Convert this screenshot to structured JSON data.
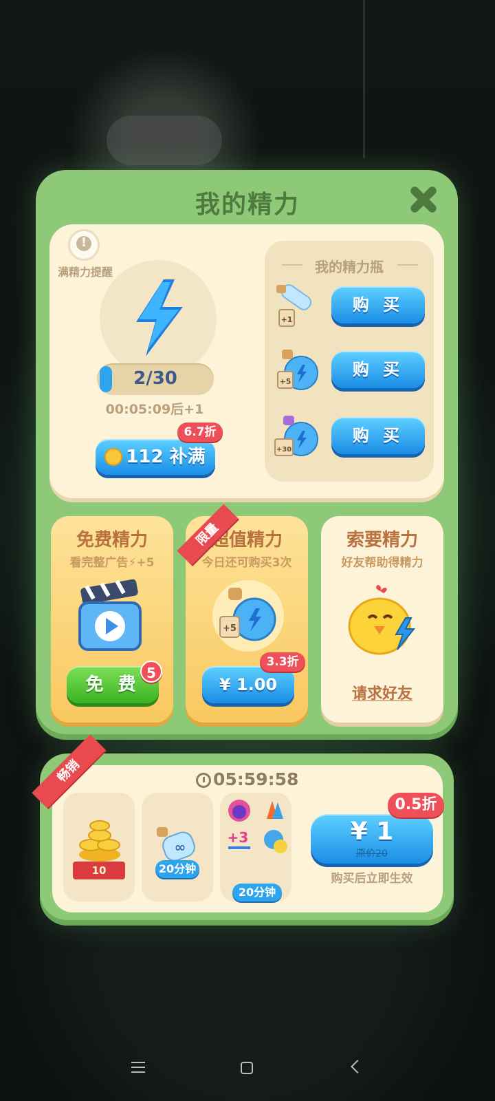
{
  "dialog": {
    "title": "我的精力",
    "reminder_label": "满精力提醒",
    "energy": {
      "current": 2,
      "max": 30,
      "text": "2/30",
      "fill_fraction": 0.067
    },
    "timer_text": "00:05:09后+1",
    "fill_button": {
      "label": "112 补满",
      "discount": "6.7折"
    }
  },
  "bottles": {
    "title": "我的精力瓶",
    "items": [
      {
        "tag": "+1",
        "buy_label": "购 买"
      },
      {
        "tag": "+5",
        "buy_label": "购 买"
      },
      {
        "tag": "+30",
        "buy_label": "购 买"
      }
    ]
  },
  "cards": [
    {
      "title": "免费精力",
      "subtitle": "看完整广告⚡+5",
      "button": "免 费",
      "badge": "5"
    },
    {
      "title": "超值精力",
      "subtitle": "今日还可购买3次",
      "ribbon": "限量",
      "tag": "+5",
      "button": "¥ 1.00",
      "discount": "3.3折"
    },
    {
      "title": "索要精力",
      "subtitle": "好友帮助得精力",
      "link": "请求好友"
    }
  ],
  "offer": {
    "ribbon": "畅销",
    "countdown": "05:59:58",
    "coins_label": "10",
    "bottle_duration": "20分钟",
    "booster_duration": "20分钟",
    "booster_plus": "+3",
    "price": "¥ 1",
    "original_price": "原价20",
    "discount": "0.5折",
    "note": "购买后立即生效"
  },
  "colors": {
    "panel_green": "#8ec977",
    "title_green": "#4f7a3f",
    "button_blue": "#1a8ee6",
    "button_green": "#3ab322",
    "badge_red": "#ee4f58",
    "card_brown": "#b8713f"
  }
}
